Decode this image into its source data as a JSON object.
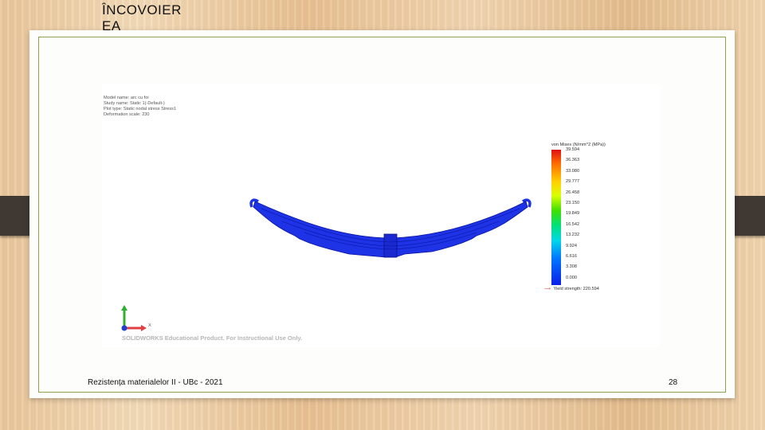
{
  "slide": {
    "title_lines": [
      "ÎNCOVOIER",
      "EA"
    ],
    "footer": "Rezistența materialelor II - UBc - 2021",
    "page_number": "28"
  },
  "simulation": {
    "info_lines": [
      "Model name: arc cu foi",
      "Study name: Static 1(-Default-)",
      "Plot type: Static nodal stress Stress1",
      "Deformation scale: 230"
    ],
    "legend_title": "von Mises (N/mm^2 (MPa))",
    "legend_ticks": [
      "39.594",
      "36.363",
      "33.080",
      "29.777",
      "26.458",
      "23.150",
      "19.849",
      "16.542",
      "13.232",
      "9.924",
      "6.616",
      "3.308",
      "0.000"
    ],
    "yield_strength": "Yield strength: 220.594",
    "watermark": "SOLIDWORKS Educational Product. For Instructional Use Only.",
    "axis_x_label": "X",
    "colors": {
      "part_fill": "#1e32e6",
      "part_edge": "#0a14a0",
      "axis_x": "#e04040",
      "axis_y": "#30b030",
      "axis_z": "#2040d0",
      "slide_border": "#8ca24b"
    }
  }
}
